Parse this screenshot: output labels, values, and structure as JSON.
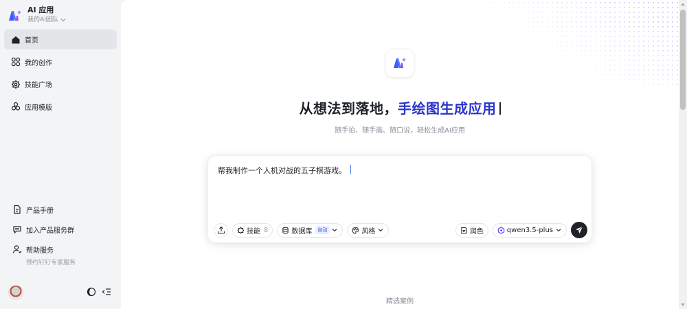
{
  "app": {
    "title": "AI 应用",
    "team": "我的AI团队"
  },
  "sidebar": {
    "items": [
      {
        "label": "首页",
        "icon": "home-icon",
        "active": true
      },
      {
        "label": "我的创作",
        "icon": "grid-circles-icon",
        "active": false
      },
      {
        "label": "技能广场",
        "icon": "skills-icon",
        "active": false
      },
      {
        "label": "应用模版",
        "icon": "templates-icon",
        "active": false
      }
    ],
    "bottom": [
      {
        "label": "产品手册",
        "icon": "document-icon"
      },
      {
        "label": "加入产品服务群",
        "icon": "chat-icon"
      },
      {
        "label": "帮助服务",
        "icon": "user-help-icon",
        "sub": "预约钉钉专家服务"
      }
    ]
  },
  "main": {
    "headline_prefix": "从想法到落地，",
    "headline_highlight": "手绘图生成应用",
    "subline": "随手拍、随手画、随口说，轻松生成AI应用",
    "prompt_text": "帮我制作一个人机对战的五子棋游戏。",
    "toolbar": {
      "skills_label": "技能",
      "skills_count": "8",
      "database_label": "数据库",
      "database_badge": "自动",
      "style_label": "风格",
      "polish_label": "润色",
      "model_label": "qwen3.5-plus"
    },
    "featured_label": "精选案例"
  },
  "colors": {
    "accent": "#2a35c9",
    "brand_blue": "#3d5afe",
    "brand_purple": "#8e4cf5"
  }
}
